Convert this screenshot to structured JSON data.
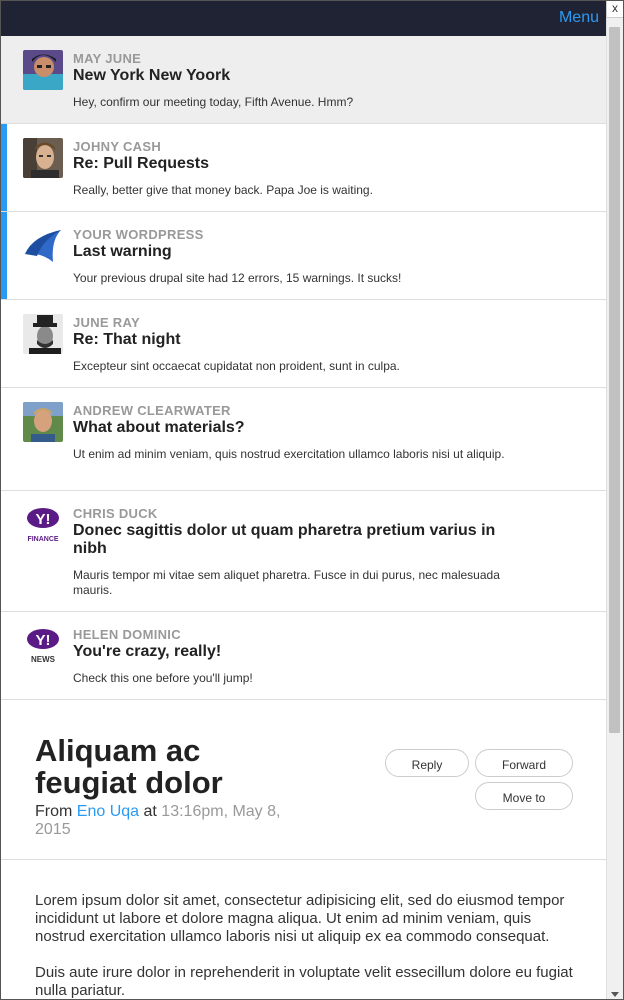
{
  "topbar": {
    "menu_label": "Menu",
    "close_label": "x"
  },
  "messages": [
    {
      "sender": "May June",
      "subject": "New York New Yoork",
      "preview": "Hey, confirm our meeting today, Fifth Avenue. Hmm?",
      "avatar": "person-photo-icon",
      "selected": true,
      "unread": false
    },
    {
      "sender": "Johny Cash",
      "subject": "Re: Pull Requests",
      "preview": "Really, better give that money back. Papa Joe is waiting.",
      "avatar": "person-photo-icon",
      "selected": false,
      "unread": true
    },
    {
      "sender": "Your WordPress",
      "subject": "Last warning",
      "preview": "Your previous drupal site had 12 errors, 15 warnings. It sucks!",
      "avatar": "blue-flag-icon",
      "selected": false,
      "unread": true
    },
    {
      "sender": "June Ray",
      "subject": "Re: That night",
      "preview": "Excepteur sint occaecat cupidatat non proident, sunt in culpa.",
      "avatar": "person-photo-icon",
      "selected": false,
      "unread": false
    },
    {
      "sender": "Andrew Clearwater",
      "subject": "What about materials?",
      "preview": "Ut enim ad minim veniam, quis nostrud exercitation ullamco laboris nisi ut aliquip.",
      "avatar": "person-photo-icon",
      "selected": false,
      "unread": false
    },
    {
      "sender": "Chris Duck",
      "subject": "Donec sagittis dolor ut quam pharetra pretium varius in nibh",
      "preview": "Mauris tempor mi vitae sem aliquet pharetra. Fusce in dui purus, nec malesuada mauris.",
      "avatar": "yahoo-finance-logo",
      "logo_text": "Y!",
      "logo_sub": "FINANCE",
      "selected": false,
      "unread": false
    },
    {
      "sender": "Helen Dominic",
      "subject": "You're crazy, really!",
      "preview": "Check this one before you'll jump!",
      "avatar": "yahoo-news-logo",
      "logo_text": "Y!",
      "logo_sub": "NEWS",
      "selected": false,
      "unread": false
    }
  ],
  "detail": {
    "title": "Aliquam ac feugiat dolor",
    "from_label": "From",
    "author": "Eno Uqa",
    "at_label": "at",
    "timestamp": "13:16pm, May 8, 2015",
    "buttons": {
      "reply": "Reply",
      "forward": "Forward",
      "move": "Move to"
    },
    "body": [
      "Lorem ipsum dolor sit amet, consectetur adipisicing elit, sed do eiusmod tempor incididunt ut labore et dolore magna aliqua. Ut enim ad minim veniam, quis nostrud exercitation ullamco laboris nisi ut aliquip ex ea commodo consequat.",
      "Duis aute irure dolor in reprehenderit in voluptate velit essecillum dolore eu fugiat nulla pariatur."
    ]
  },
  "colors": {
    "accent": "#2b9af3",
    "topbar": "#1f2333",
    "selected_bg": "#eeeeee"
  }
}
